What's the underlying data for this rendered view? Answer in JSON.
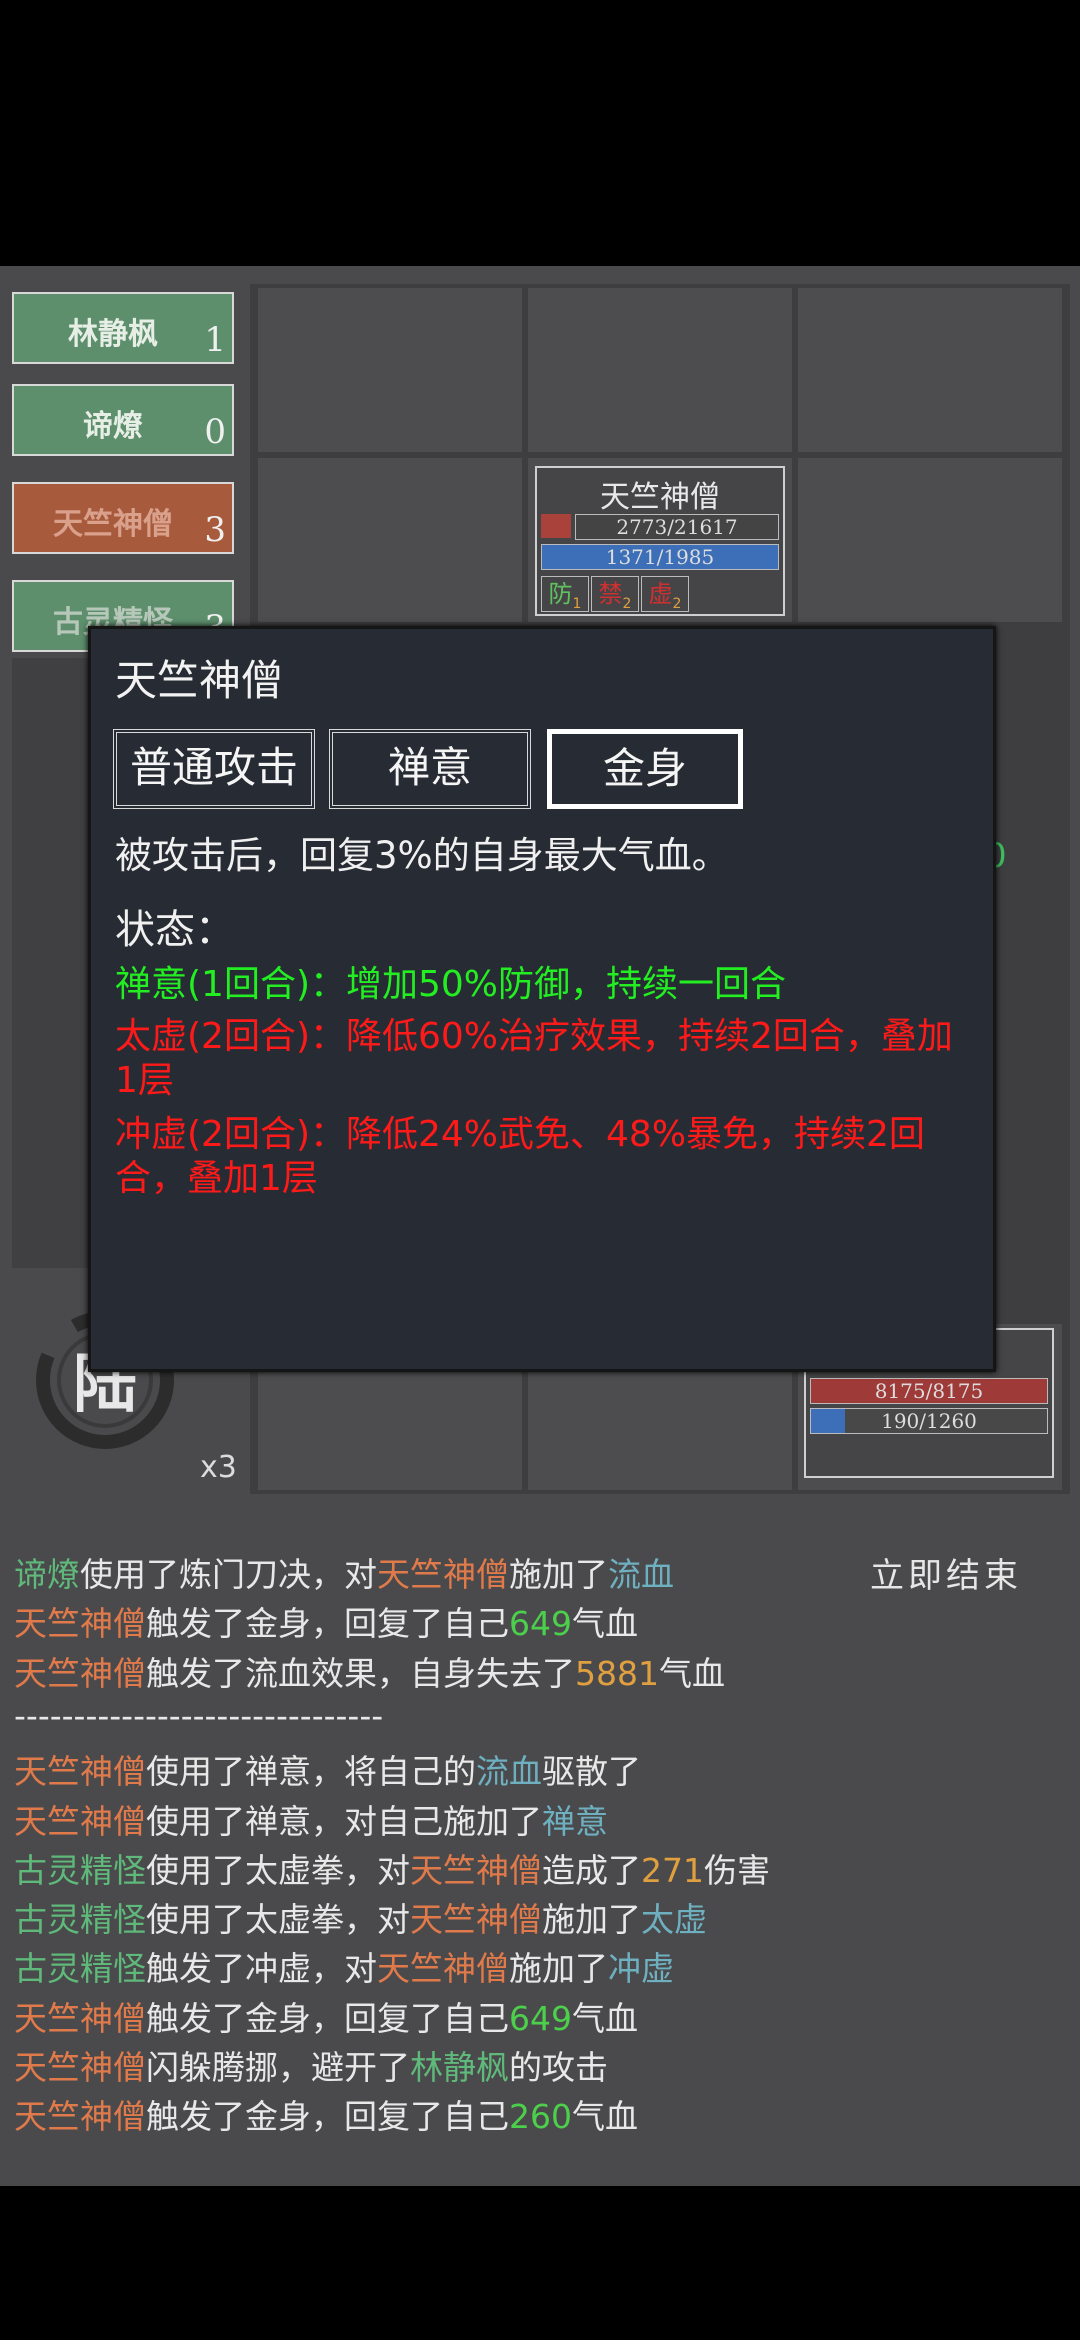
{
  "sidebar": {
    "teams": [
      {
        "name": "林静枫",
        "count": "1"
      },
      {
        "name": "谛燎",
        "count": "0"
      },
      {
        "name": "天竺神僧",
        "count": "3"
      },
      {
        "name": "古灵精怪",
        "count": "3"
      }
    ]
  },
  "board": {
    "enemy_card": {
      "name": "天竺神僧",
      "hp": "2773/21617",
      "mp": "1371/1985",
      "buffs": [
        {
          "label": "防",
          "n": "1"
        },
        {
          "label": "禁",
          "n": "2"
        },
        {
          "label": "虚",
          "n": "2"
        }
      ]
    },
    "ally_card": {
      "hp": "8175/8175",
      "mp": "190/1260"
    },
    "partial_number": "0",
    "seal_glyph": "陆",
    "speed": "x3"
  },
  "popup": {
    "title": "天竺神僧",
    "skills": [
      "普通攻击",
      "禅意",
      "金身"
    ],
    "selected": 2,
    "description": "被攻击后，回复3%的自身最大气血。",
    "status_header": "状态：",
    "statuses": [
      {
        "text": "禅意(1回合)：增加50%防御，持续一回合",
        "kind": "buff"
      },
      {
        "text": "太虚(2回合)：降低60%治疗效果，持续2回合，叠加1层",
        "kind": "debuff"
      },
      {
        "text": "冲虚(2回合)：降低24%武免、48%暴免，持续2回合，叠加1层",
        "kind": "debuff"
      }
    ]
  },
  "end_button": "立即结束",
  "log": [
    [
      {
        "t": "谛燎",
        "c": "green"
      },
      {
        "t": "使用了炼门刀决，对"
      },
      {
        "t": "天竺神僧",
        "c": "red"
      },
      {
        "t": "施加了"
      },
      {
        "t": "流血",
        "c": "blue"
      }
    ],
    [
      {
        "t": "天竺神僧",
        "c": "red"
      },
      {
        "t": "触发了金身，回复了自己"
      },
      {
        "t": "649",
        "c": "numg"
      },
      {
        "t": "气血"
      }
    ],
    [
      {
        "t": "天竺神僧",
        "c": "red"
      },
      {
        "t": "触发了流血效果，自身失去了"
      },
      {
        "t": "5881",
        "c": "numo"
      },
      {
        "t": "气血"
      }
    ],
    [
      {
        "t": "-------------------------------"
      }
    ],
    [
      {
        "t": "天竺神僧",
        "c": "red"
      },
      {
        "t": "使用了禅意，将自己的"
      },
      {
        "t": "流血",
        "c": "blue"
      },
      {
        "t": "驱散了"
      }
    ],
    [
      {
        "t": "天竺神僧",
        "c": "red"
      },
      {
        "t": "使用了禅意，对自己施加了"
      },
      {
        "t": "禅意",
        "c": "blue"
      }
    ],
    [
      {
        "t": "古灵精怪",
        "c": "green"
      },
      {
        "t": "使用了太虚拳，对"
      },
      {
        "t": "天竺神僧",
        "c": "red"
      },
      {
        "t": "造成了"
      },
      {
        "t": "271",
        "c": "numo"
      },
      {
        "t": "伤害"
      }
    ],
    [
      {
        "t": "古灵精怪",
        "c": "green"
      },
      {
        "t": "使用了太虚拳，对"
      },
      {
        "t": "天竺神僧",
        "c": "red"
      },
      {
        "t": "施加了"
      },
      {
        "t": "太虚",
        "c": "blue"
      }
    ],
    [
      {
        "t": "古灵精怪",
        "c": "green"
      },
      {
        "t": "触发了冲虚，对"
      },
      {
        "t": "天竺神僧",
        "c": "red"
      },
      {
        "t": "施加了"
      },
      {
        "t": "冲虚",
        "c": "blue"
      }
    ],
    [
      {
        "t": "天竺神僧",
        "c": "red"
      },
      {
        "t": "触发了金身，回复了自己"
      },
      {
        "t": "649",
        "c": "numg"
      },
      {
        "t": "气血"
      }
    ],
    [
      {
        "t": "天竺神僧",
        "c": "red"
      },
      {
        "t": "闪躲腾挪，避开了"
      },
      {
        "t": "林静枫",
        "c": "green"
      },
      {
        "t": "的攻击"
      }
    ],
    [
      {
        "t": "天竺神僧",
        "c": "red"
      },
      {
        "t": "触发了金身，回复了自己"
      },
      {
        "t": "260",
        "c": "numg"
      },
      {
        "t": "气血"
      }
    ]
  ]
}
